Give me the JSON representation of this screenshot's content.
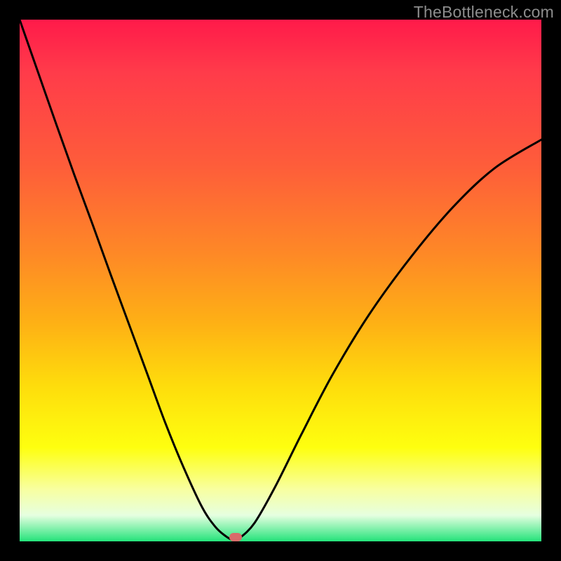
{
  "watermark": "TheBottleneck.com",
  "marker": {
    "cx_frac": 0.414,
    "cy_frac": 1.0
  },
  "chart_data": {
    "type": "line",
    "title": "",
    "xlabel": "",
    "ylabel": "",
    "xlim": [
      0,
      1
    ],
    "ylim": [
      0,
      1
    ],
    "series": [
      {
        "name": "bottleneck-curve",
        "x": [
          0.0,
          0.035,
          0.07,
          0.105,
          0.14,
          0.175,
          0.21,
          0.245,
          0.28,
          0.315,
          0.35,
          0.375,
          0.395,
          0.41,
          0.42,
          0.45,
          0.49,
          0.54,
          0.6,
          0.67,
          0.75,
          0.83,
          0.91,
          1.0
        ],
        "y": [
          1.0,
          0.9,
          0.8,
          0.702,
          0.607,
          0.51,
          0.415,
          0.32,
          0.225,
          0.14,
          0.065,
          0.028,
          0.01,
          0.002,
          0.005,
          0.035,
          0.105,
          0.205,
          0.32,
          0.435,
          0.545,
          0.64,
          0.715,
          0.77
        ]
      }
    ],
    "annotations": [
      {
        "type": "marker",
        "shape": "pill",
        "color": "#d96a6a",
        "x": 0.414,
        "y": 0.0
      }
    ]
  }
}
